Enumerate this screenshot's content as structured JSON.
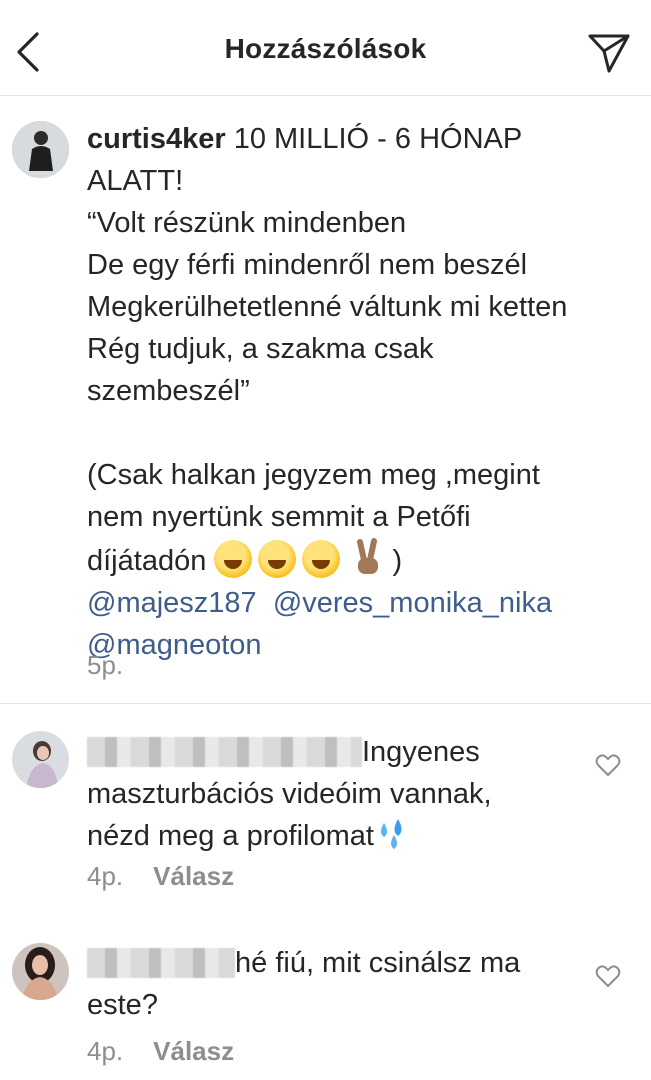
{
  "header": {
    "title": "Hozzászólások"
  },
  "comments": [
    {
      "username": "curtis4ker",
      "text_line1": " 10 MILLIÓ - 6 HÓNAP",
      "text_rest": "ALATT!\n“Volt részünk mindenben\nDe egy férfi mindenről nem beszél\nMegkerülhetetlenné váltunk mi ketten\nRég tudjuk, a szakma csak\nszembeszél”\n\n(Csak halkan jegyzem meg ,megint\nnem nyertünk semmit a Petőfi\ndíjátadón",
      "text_after_emoji": " )",
      "mention1": "@majesz187",
      "mention2": "@veres_monika_nika",
      "mention3": "@magneoton",
      "time": "5p."
    },
    {
      "text_line1": "Ingyenes",
      "text_rest": "maszturbációs videóim vannak,\nnézd meg a profilomat",
      "time": "4p.",
      "reply_label": "Válasz"
    },
    {
      "text_line1": "hé fiú, mit csinálsz ma",
      "text_rest": "este?",
      "time": "4p.",
      "reply_label": "Válasz"
    }
  ],
  "icons": {
    "back": "chevron-left-icon",
    "share": "paper-plane-icon",
    "like": "heart-outline-icon"
  }
}
